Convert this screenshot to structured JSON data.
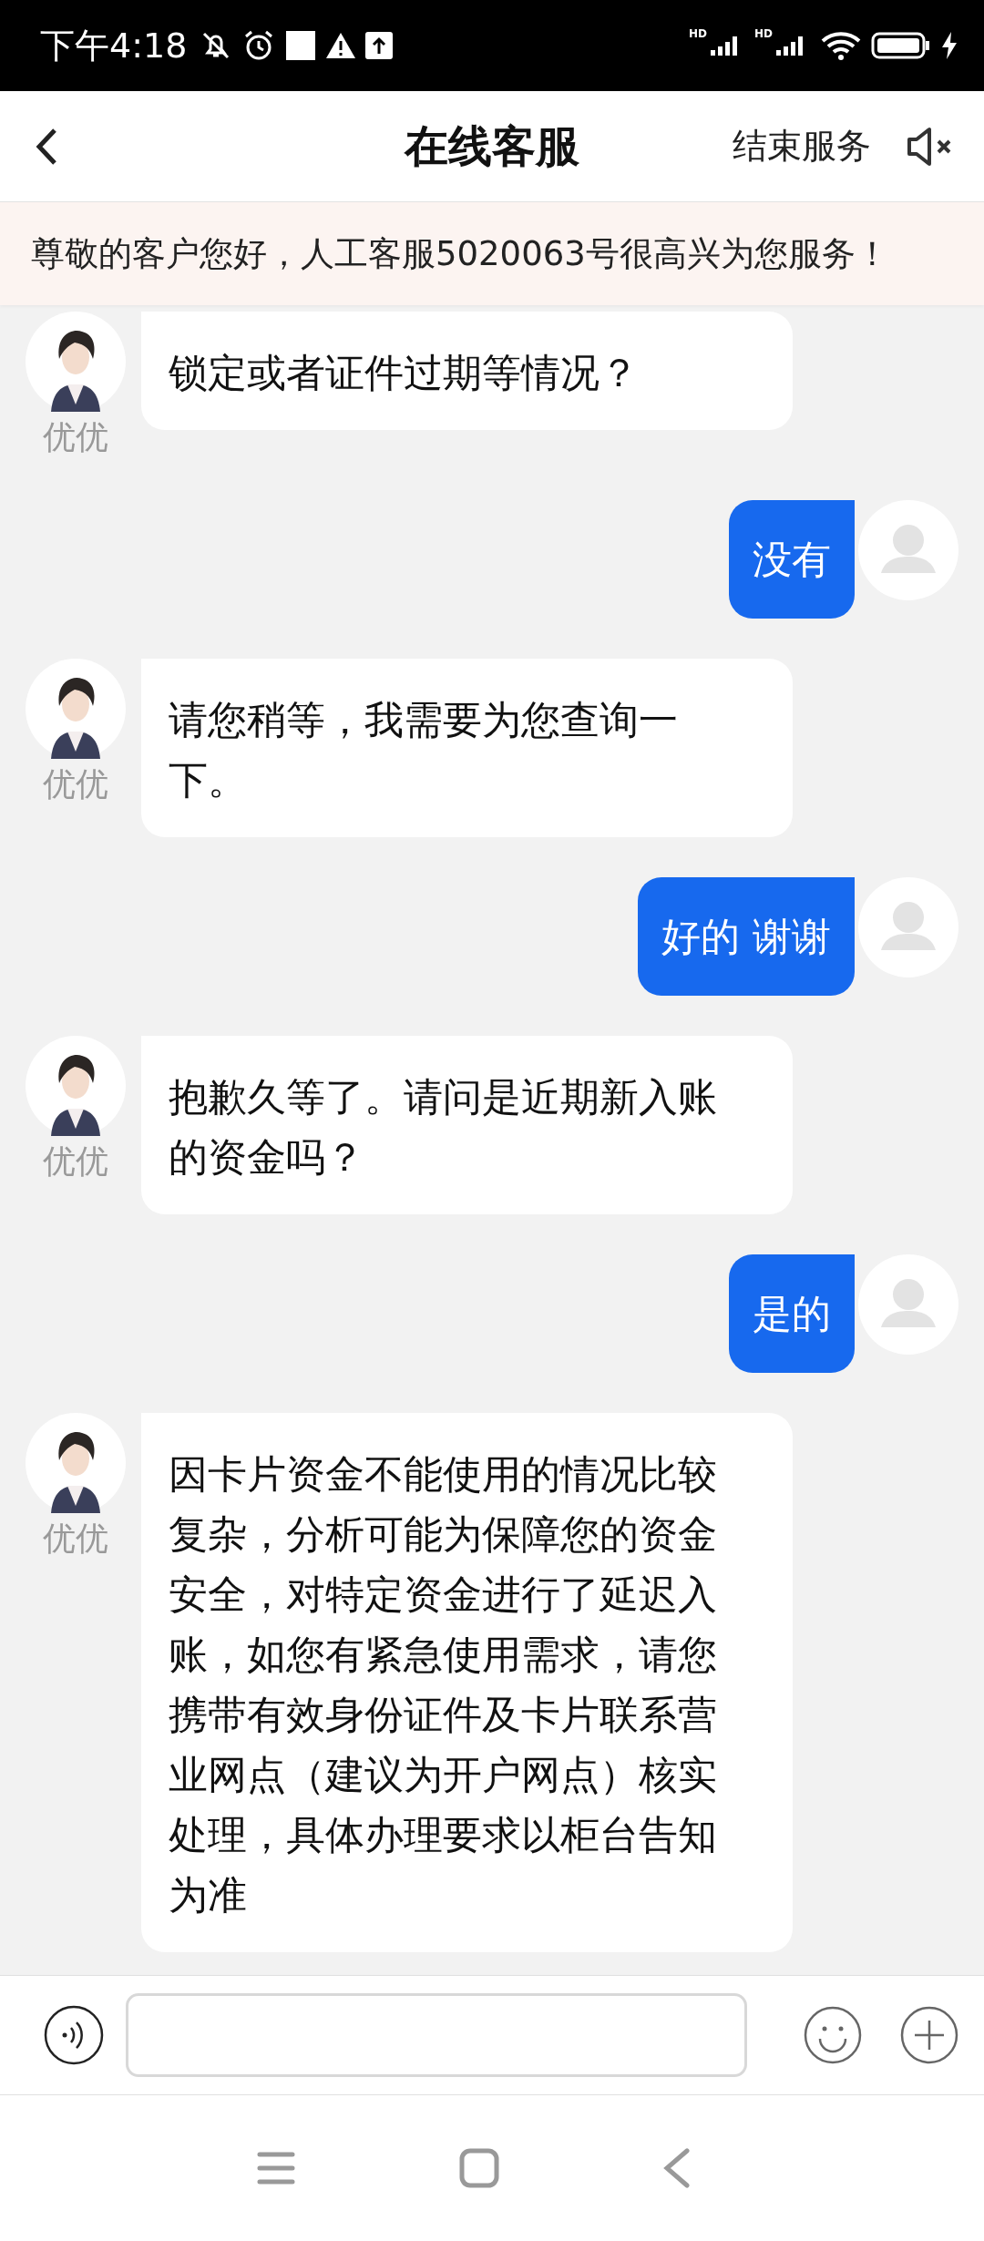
{
  "status_bar": {
    "time": "下午4:18",
    "network_labels": [
      "HD",
      "HD"
    ]
  },
  "header": {
    "title": "在线客服",
    "end_button": "结束服务"
  },
  "notice": "尊敬的客户您好，人工客服5020063号很高兴为您服务！",
  "messages": [
    {
      "kind": "agent",
      "name": "优优",
      "text": "锁定或者证件过期等情况？"
    },
    {
      "kind": "user",
      "text": "没有"
    },
    {
      "kind": "agent",
      "name": "优优",
      "text": "请您稍等，我需要为您查询一下。"
    },
    {
      "kind": "user",
      "text": "好的 谢谢"
    },
    {
      "kind": "agent",
      "name": "优优",
      "text": "抱歉久等了。请问是近期新入账的资金吗？"
    },
    {
      "kind": "user",
      "text": "是的"
    },
    {
      "kind": "agent",
      "name": "优优",
      "text": "因卡片资金不能使用的情况比较复杂，分析可能为保障您的资金安全，对特定资金进行了延迟入账，如您有紧急使用需求，请您携带有效身份证件及卡片联系营业网点（建议为开户网点）核实处理，具体办理要求以柜台告知为准"
    }
  ]
}
